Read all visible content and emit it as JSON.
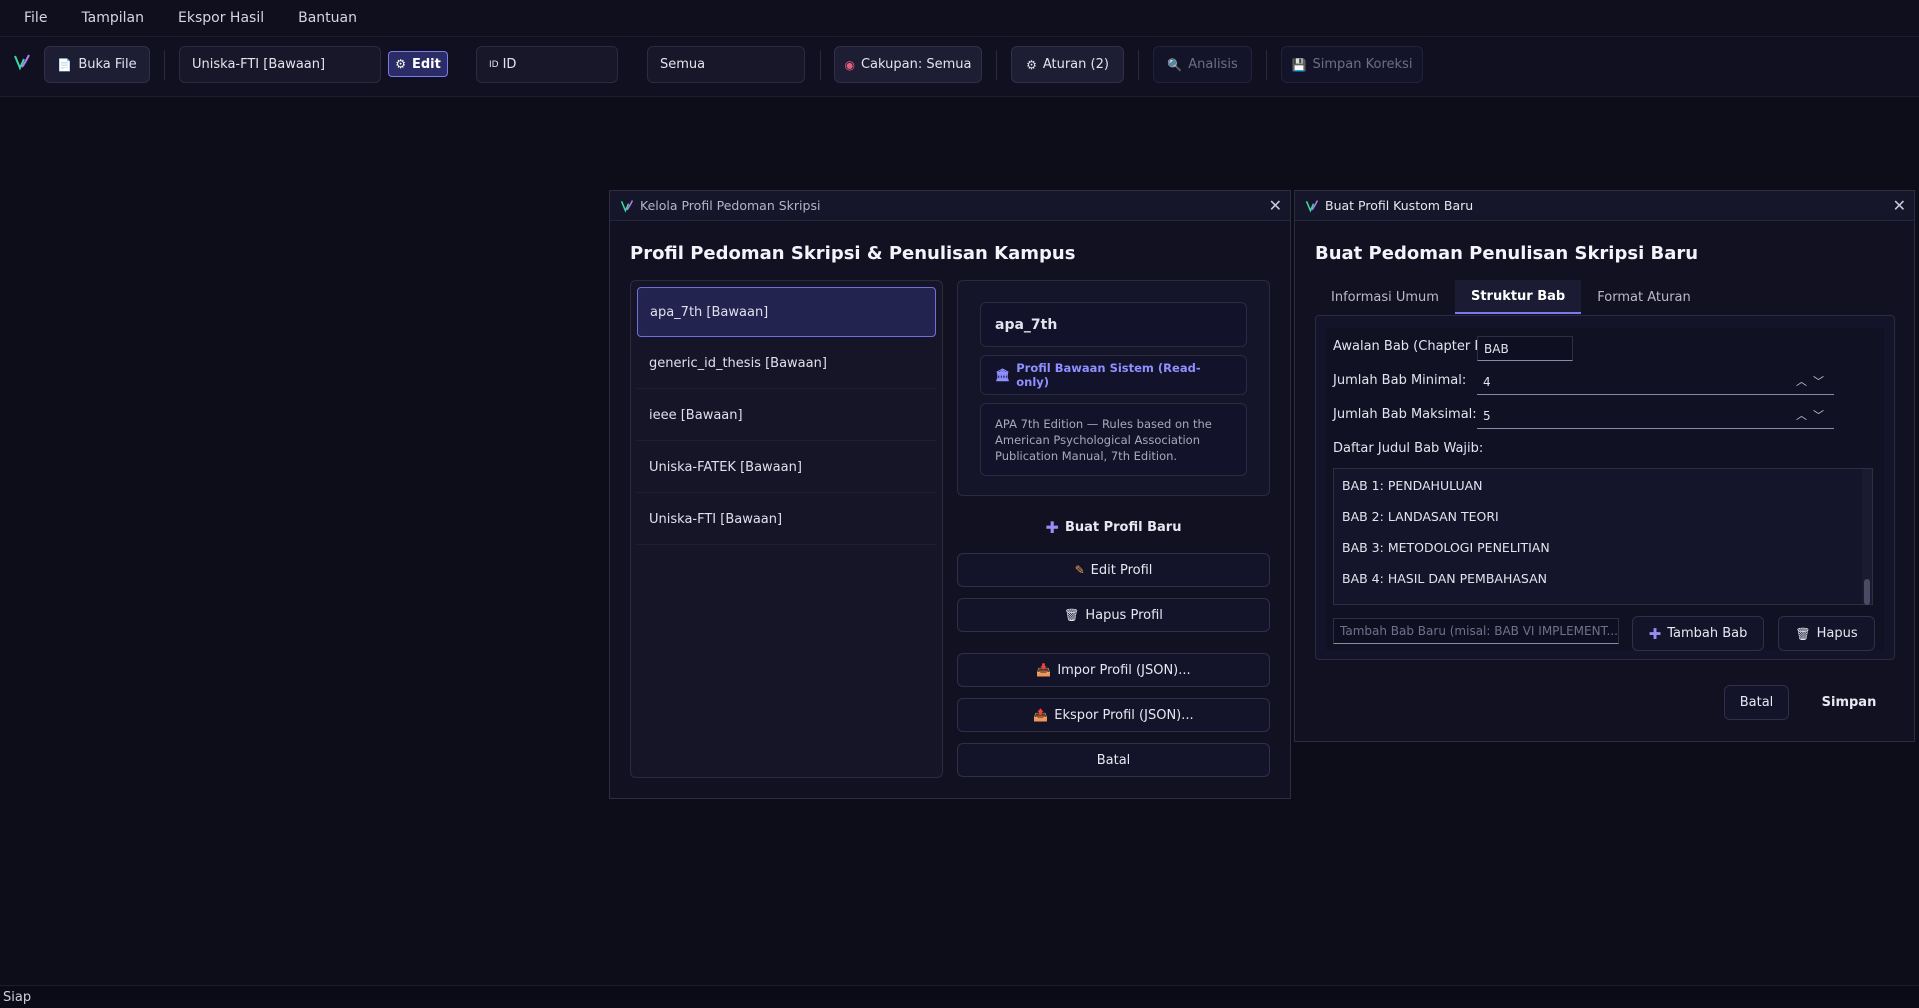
{
  "menu": [
    "File",
    "Tampilan",
    "Ekspor Hasil",
    "Bantuan"
  ],
  "toolbar": {
    "open_file": "Buka File",
    "profile_select": "Uniska-FTI [Bawaan]",
    "edit": "Edit",
    "lang_prefix": "ID",
    "lang": "ID",
    "filter": "Semua",
    "scope": "Cakupan: Semua",
    "rules": "Aturan (2)",
    "analyze": "Analisis",
    "save_corrections": "Simpan Koreksi"
  },
  "manage_dialog": {
    "title": "Kelola Profil Pedoman Skripsi",
    "heading": "Profil Pedoman Skripsi & Penulisan Kampus",
    "profiles": [
      "apa_7th [Bawaan]",
      "generic_id_thesis [Bawaan]",
      "ieee [Bawaan]",
      "Uniska-FATEK [Bawaan]",
      "Uniska-FTI [Bawaan]"
    ],
    "selected_index": 0,
    "detail": {
      "name": "apa_7th",
      "badge": "Profil Bawaan Sistem (Read-only)",
      "description": "APA 7th Edition — Rules based on the American Psychological Association Publication Manual, 7th Edition."
    },
    "buttons": {
      "new": "Buat Profil Baru",
      "edit": "Edit Profil",
      "delete": "Hapus Profil",
      "import": "Impor Profil (JSON)...",
      "export": "Ekspor Profil (JSON)...",
      "cancel": "Batal"
    }
  },
  "new_dialog": {
    "title": "Buat Profil Kustom Baru",
    "heading": "Buat Pedoman Penulisan Skripsi Baru",
    "tabs": [
      "Informasi Umum",
      "Struktur Bab",
      "Format  Aturan"
    ],
    "active_tab": 1,
    "fields": {
      "prefix_label": "Awalan Bab (Chapter Prefix):",
      "prefix_value": "BAB",
      "min_label": "Jumlah Bab Minimal:",
      "min_value": "4",
      "max_label": "Jumlah Bab Maksimal:",
      "max_value": "5",
      "list_label": "Daftar Judul Bab Wajib:"
    },
    "chapters": [
      "BAB 1: PENDAHULUAN",
      "BAB 2: LANDASAN TEORI",
      "BAB 3: METODOLOGI PENELITIAN",
      "BAB 4: HASIL DAN PEMBAHASAN"
    ],
    "add_placeholder": "Tambah Bab Baru (misal: BAB VI IMPLEMENT...",
    "add_button": "Tambah Bab",
    "remove_button": "Hapus",
    "cancel": "Batal",
    "save": "Simpan"
  },
  "status": "Siap",
  "colors": {
    "accent": "#7b7bf0",
    "badge": "#8f8fff",
    "background": "#0d0d1a"
  }
}
